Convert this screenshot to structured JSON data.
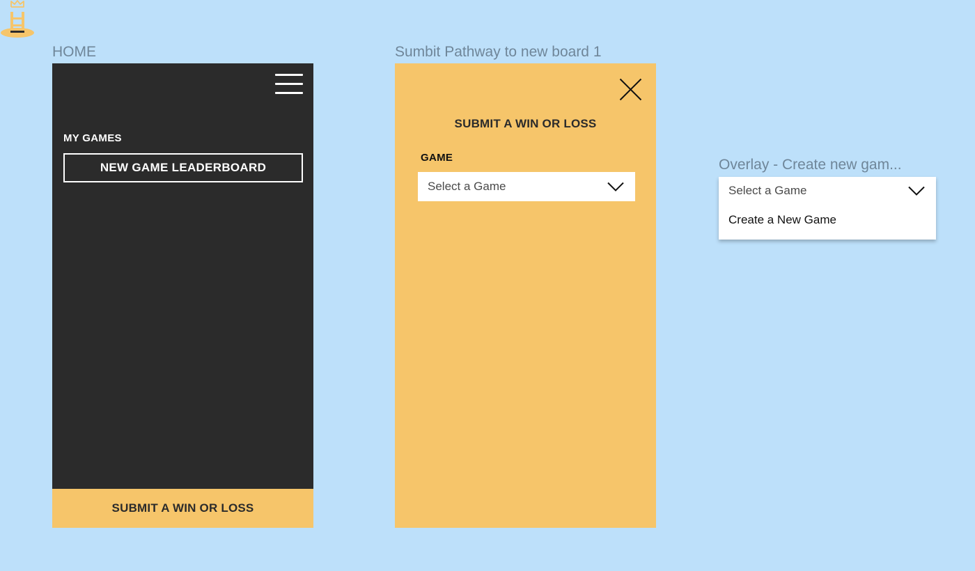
{
  "frames": {
    "home_label": "HOME",
    "submit_label": "Sumbit Pathway to new board 1",
    "overlay_label": "Overlay - Create new gam..."
  },
  "home": {
    "section_title": "MY GAMES",
    "leaderboard_button": "NEW GAME LEADERBOARD",
    "submit_button": "SUBMIT A WIN OR LOSS"
  },
  "submit": {
    "title": "SUBMIT A WIN OR LOSS",
    "game_label": "GAME",
    "select_placeholder": "Select a Game"
  },
  "overlay": {
    "select_placeholder": "Select a Game",
    "option_create": "Create a New Game"
  },
  "colors": {
    "background": "#bde0fa",
    "dark": "#2b2b2b",
    "accent": "#f6c56a",
    "label": "#6f8699"
  },
  "icons": [
    "ladder-crown-logo-icon",
    "hamburger-menu-icon",
    "close-icon",
    "chevron-down-icon"
  ]
}
